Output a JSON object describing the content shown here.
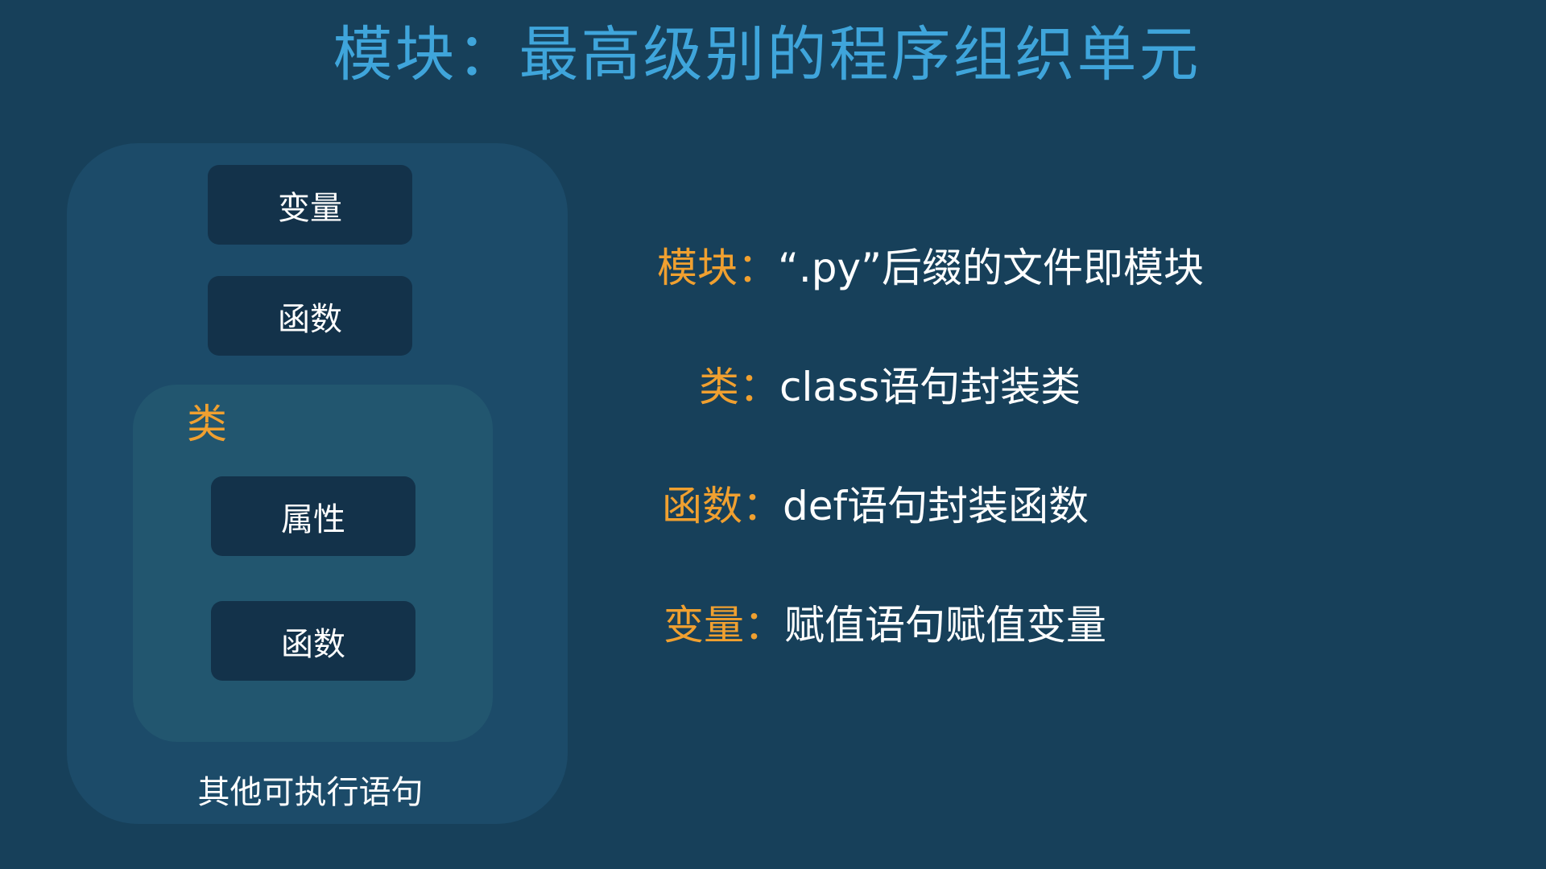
{
  "title": "模块：最高级别的程序组织单元",
  "diagram": {
    "module_items": {
      "variable": "变量",
      "function": "函数"
    },
    "class_label": "类",
    "class_items": {
      "attribute": "属性",
      "function": "函数"
    },
    "other_statements": "其他可执行语句"
  },
  "definitions": [
    {
      "term": "模块：",
      "desc": "“.py”后缀的文件即模块"
    },
    {
      "term": "类：",
      "desc": "class语句封装类"
    },
    {
      "term": "函数：",
      "desc": "def语句封装函数"
    },
    {
      "term": "变量：",
      "desc": "赋值语句赋值变量"
    }
  ],
  "colors": {
    "background": "#17405a",
    "title": "#3fa5db",
    "accent": "#f0a030",
    "text": "#ffffff"
  }
}
